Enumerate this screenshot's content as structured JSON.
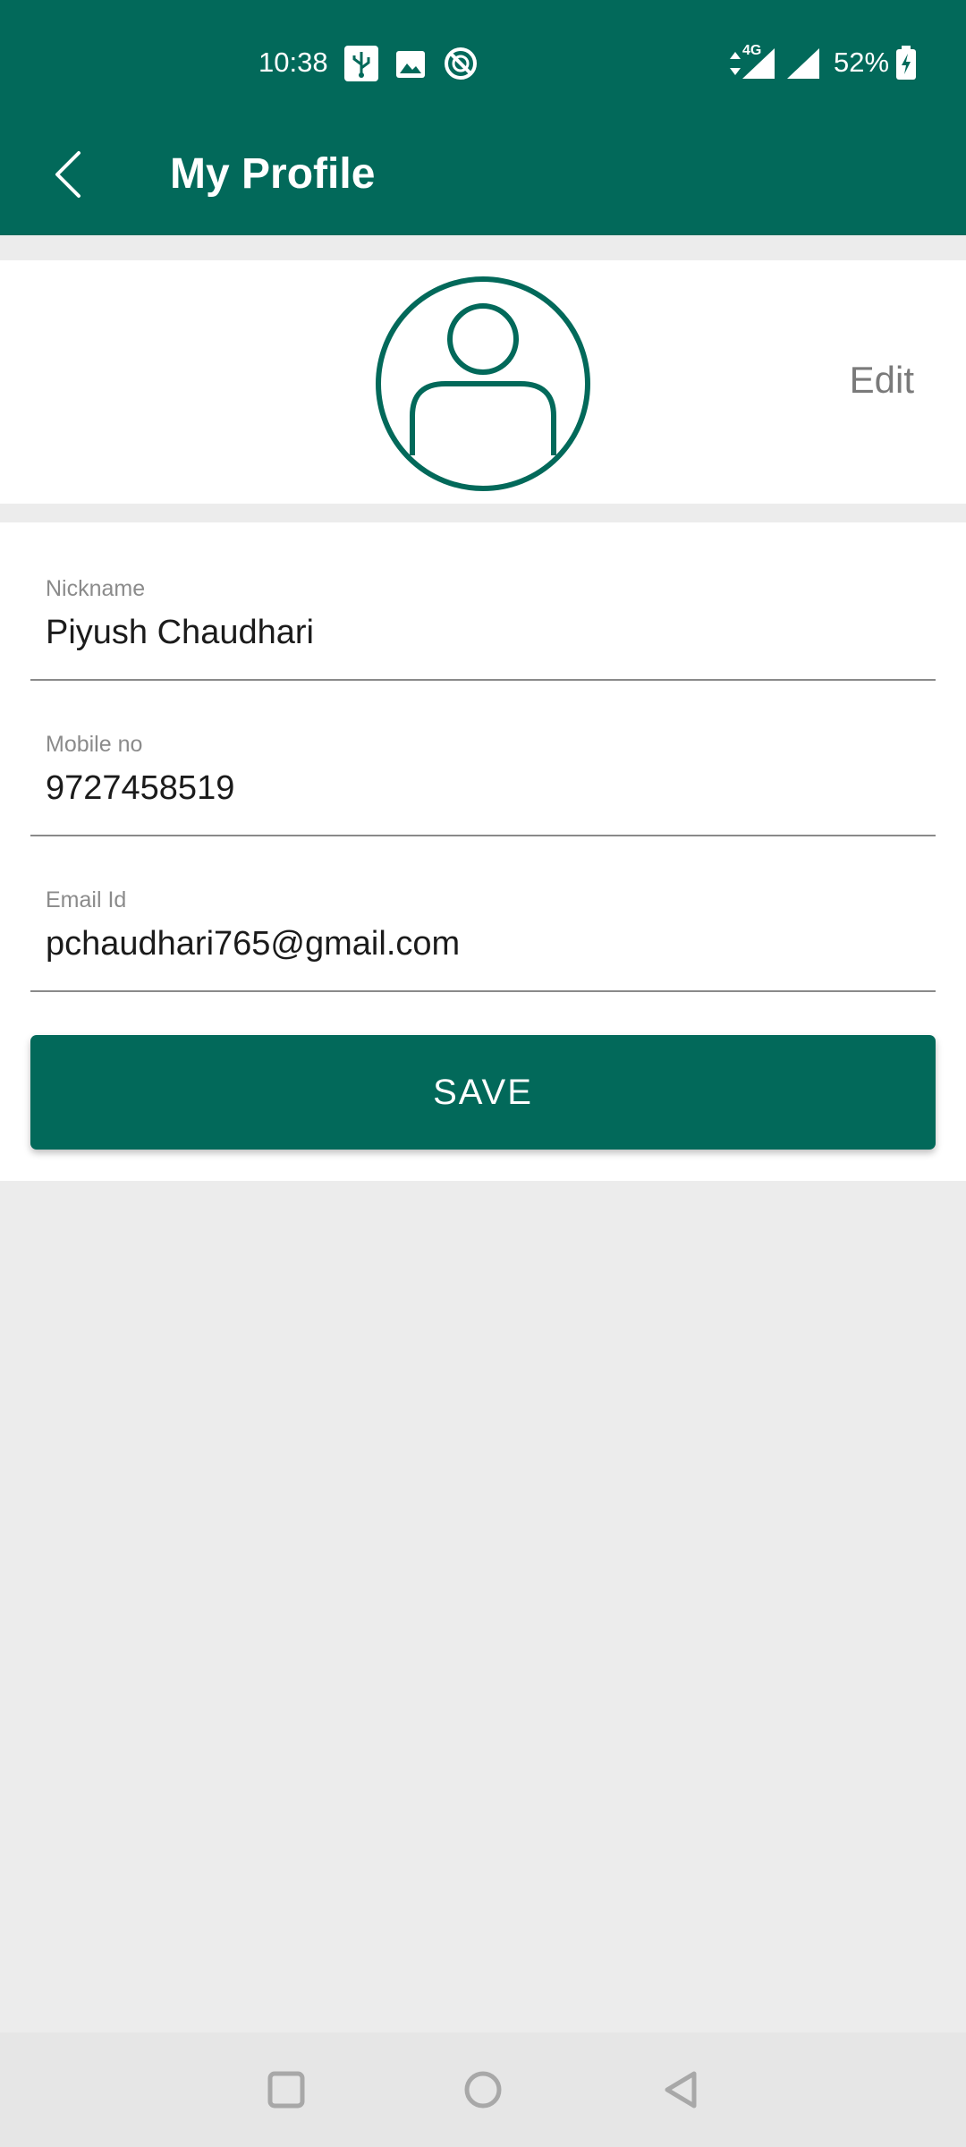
{
  "status_bar": {
    "time": "10:38",
    "network_label": "4G",
    "battery": "52%",
    "icons": [
      "usb-icon",
      "image-icon",
      "dnd-icon",
      "data-arrows-icon",
      "signal-icon",
      "signal-icon",
      "battery-charging-icon"
    ]
  },
  "app_bar": {
    "title": "My Profile",
    "back_icon": "chevron-left-icon"
  },
  "profile": {
    "avatar_icon": "user-avatar-icon",
    "edit_label": "Edit"
  },
  "form": {
    "fields": [
      {
        "label": "Nickname",
        "value": "Piyush Chaudhari"
      },
      {
        "label": "Mobile no",
        "value": "9727458519"
      },
      {
        "label": "Email Id",
        "value": "pchaudhari765@gmail.com"
      }
    ],
    "save_label": "SAVE"
  },
  "nav_bar": {
    "icons": [
      "recents-icon",
      "home-icon",
      "back-icon"
    ]
  },
  "colors": {
    "primary": "#02695a",
    "background": "#ececec",
    "surface": "#ffffff",
    "label_gray": "#8b8b8b"
  }
}
